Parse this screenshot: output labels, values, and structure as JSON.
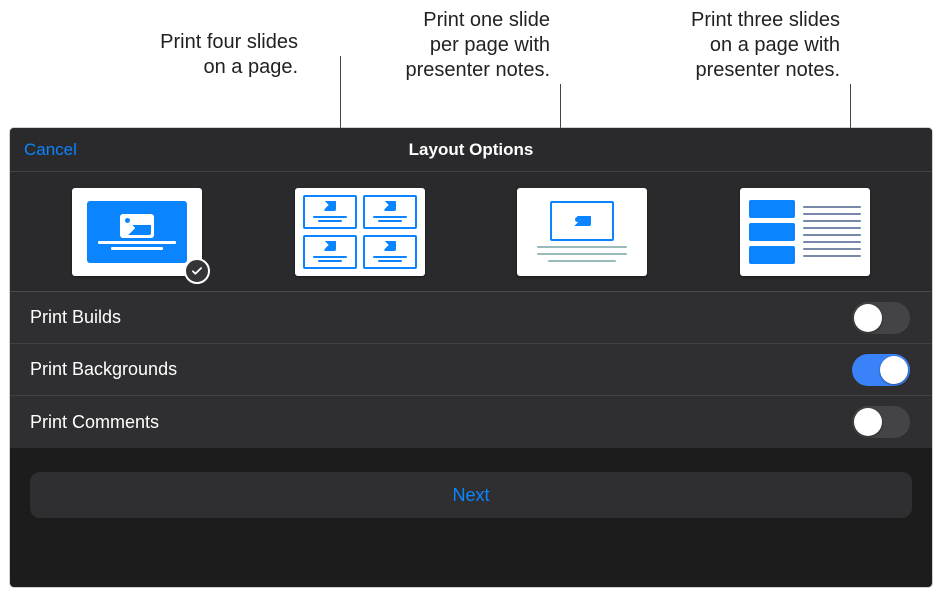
{
  "callouts": {
    "fourUp": "Print four slides\non a page.",
    "oneWithNotes": "Print one slide\nper page with\npresenter notes.",
    "threeWithNotes": "Print three slides\non a page with\npresenter notes."
  },
  "header": {
    "cancel": "Cancel",
    "title": "Layout Options"
  },
  "layouts": [
    {
      "id": "full-slide",
      "selected": true
    },
    {
      "id": "four-up",
      "selected": false
    },
    {
      "id": "one-with-notes",
      "selected": false
    },
    {
      "id": "three-with-notes",
      "selected": false
    }
  ],
  "options": {
    "printBuilds": {
      "label": "Print Builds",
      "value": false
    },
    "printBackgrounds": {
      "label": "Print Backgrounds",
      "value": true
    },
    "printComments": {
      "label": "Print Comments",
      "value": false
    }
  },
  "footer": {
    "next": "Next"
  },
  "icons": {
    "check": "check-icon"
  }
}
